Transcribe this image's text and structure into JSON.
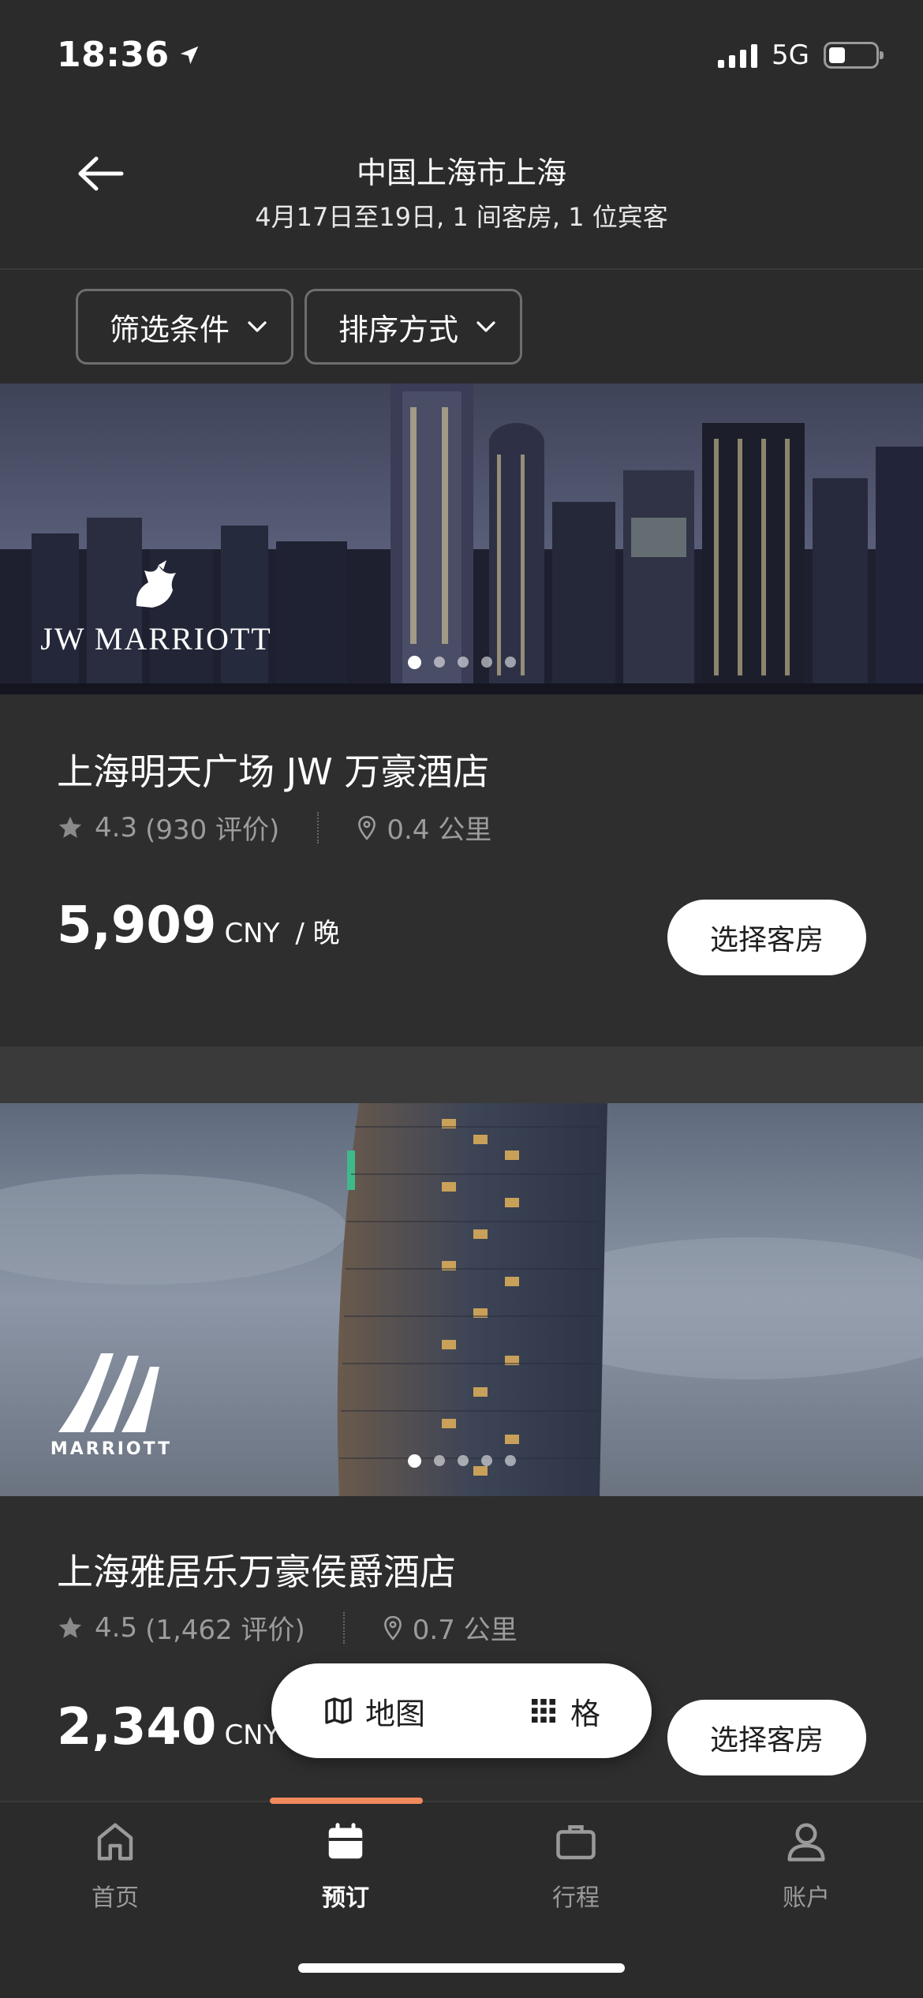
{
  "status_bar": {
    "time": "18:36",
    "network": "5G"
  },
  "header": {
    "title": "中国上海市上海",
    "subtitle": "4月17日至19日, 1 间客房, 1 位宾客"
  },
  "filters": {
    "filter_label": "筛选条件",
    "sort_label": "排序方式"
  },
  "hotels": [
    {
      "brand": "JW MARRIOTT",
      "name": "上海明天广场 JW 万豪酒店",
      "rating": "4.3",
      "reviews": "(930 评价)",
      "distance": "0.4 公里",
      "price": "5,909",
      "currency": "CNY",
      "per": "/  晚",
      "select_label": "选择客房"
    },
    {
      "brand": "MARRIOTT",
      "name": "上海雅居乐万豪侯爵酒店",
      "rating": "4.5",
      "reviews": "(1,462 评价)",
      "distance": "0.7 公里",
      "price": "2,340",
      "currency": "CNY",
      "per": "/",
      "select_label": "选择客房"
    }
  ],
  "toggle": {
    "map_label": "地图",
    "grid_label": "格"
  },
  "nav": {
    "items": [
      {
        "label": "首页",
        "icon": "home-icon"
      },
      {
        "label": "预订",
        "icon": "calendar-icon"
      },
      {
        "label": "行程",
        "icon": "briefcase-icon"
      },
      {
        "label": "账户",
        "icon": "user-icon"
      }
    ],
    "active_index": 1,
    "accent_color": "#f08a5d"
  }
}
